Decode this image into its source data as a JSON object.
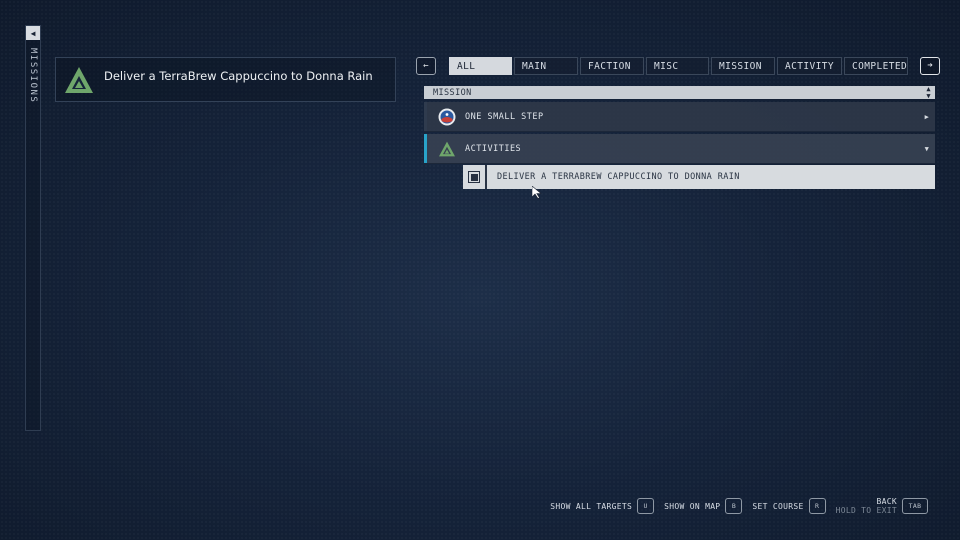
{
  "rail": {
    "label": "MISSIONS",
    "collapse_icon": "triangle-left"
  },
  "tracked": {
    "title": "Deliver a TerraBrew Cappuccino to Donna Rain",
    "icon": "activity-triangle-icon"
  },
  "nav": {
    "prev_glyph": "←",
    "next_glyph": "➜"
  },
  "tabs": [
    {
      "label": "ALL",
      "active": true
    },
    {
      "label": "MAIN"
    },
    {
      "label": "FACTION"
    },
    {
      "label": "MISC"
    },
    {
      "label": "MISSION"
    },
    {
      "label": "ACTIVITY"
    },
    {
      "label": "COMPLETED"
    }
  ],
  "list": {
    "header": "MISSION",
    "rows": [
      {
        "label": "ONE SMALL STEP",
        "icon": "constellation-badge-icon",
        "state": "collapsed"
      },
      {
        "label": "ACTIVITIES",
        "icon": "activity-triangle-icon",
        "state": "expanded"
      }
    ],
    "subitems": [
      {
        "label": "DELIVER A TERRABREW CAPPUCCINO TO DONNA RAIN",
        "selected": true
      }
    ]
  },
  "footer": {
    "show_all_targets": {
      "label": "SHOW ALL TARGETS",
      "key": "U"
    },
    "show_on_map": {
      "label": "SHOW ON MAP",
      "key": "B"
    },
    "set_course": {
      "label": "SET COURSE",
      "key": "R"
    },
    "back": {
      "label": "BACK",
      "sublabel": "HOLD TO EXIT",
      "key": "TAB"
    }
  },
  "colors": {
    "background": "#15233a",
    "accent": "#29a3c9",
    "activity_green": "#6fa66b",
    "highlight": "#d5d9de"
  }
}
